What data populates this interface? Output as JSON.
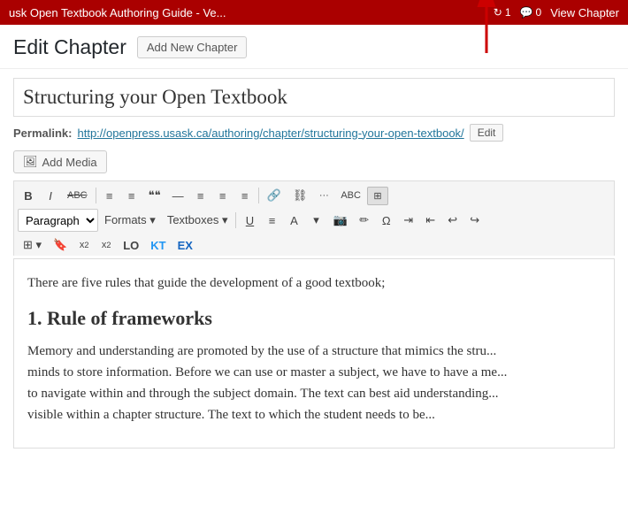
{
  "admin_bar": {
    "title": "usk Open Textbook Authoring Guide - Ve...",
    "sync_count": "1",
    "comment_count": "0",
    "view_label": "View Chapter"
  },
  "page": {
    "edit_chapter_label": "Edit Chapter",
    "add_new_chapter_label": "Add New Chapter"
  },
  "chapter": {
    "title": "Structuring your Open Textbook",
    "permalink_label": "Permalink:",
    "permalink_url": "http://openpress.usask.ca/authoring/chapter/structuring-your-open-textbook/",
    "edit_label": "Edit"
  },
  "toolbar": {
    "add_media_label": "Add Media",
    "paragraph_option": "Paragraph",
    "formats_label": "Formats",
    "textboxes_label": "Textboxes"
  },
  "editor": {
    "intro_text": "There are five rules that guide the development of a good textbook;",
    "heading1": "1. Rule of frameworks",
    "body_text": "Memory and understanding are promoted by the use of a structure that mimics the stru... minds to store information. Before we can use or master a subject, we have to have a me... to navigate within and through the subject domain. The text can best aid understanding... visible within a chapter structure. The text to which the student needs to be..."
  }
}
